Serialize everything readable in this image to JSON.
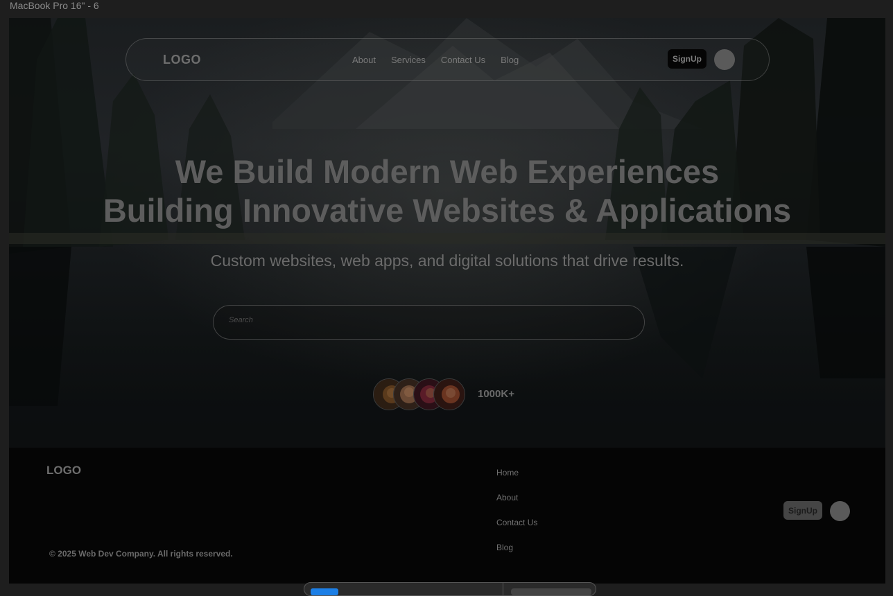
{
  "window": {
    "frame_label": "MacBook Pro 16\" - 6"
  },
  "header": {
    "logo": "LOGO",
    "nav": [
      "About",
      "Services",
      "Contact Us",
      "Blog"
    ],
    "signup": "SignUp"
  },
  "hero": {
    "headline_1": "We Build Modern Web Experiences",
    "headline_2": "Building Innovative Websites & Applications",
    "subtitle": "Custom websites, web apps, and digital solutions that drive results.",
    "search_placeholder": "Search",
    "user_count": "1000K+"
  },
  "footer": {
    "logo": "LOGO",
    "links": [
      "Home",
      "About",
      "Contact Us",
      "Blog"
    ],
    "signup": "SignUp",
    "copyright": "© 2025 Web Dev Company. All rights reserved."
  },
  "icons": {
    "profile": "profile-avatar-icon",
    "search": "search-field"
  }
}
